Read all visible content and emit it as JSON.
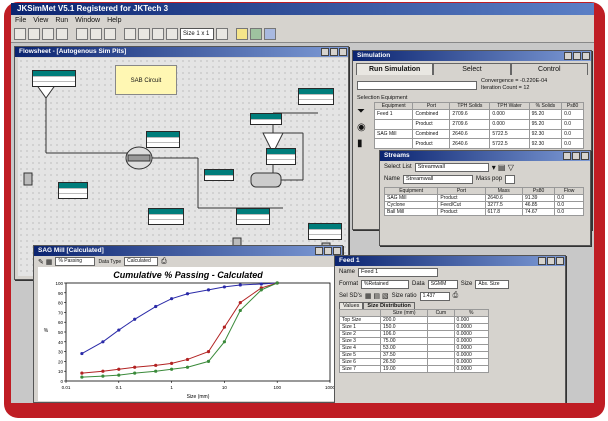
{
  "app": {
    "title": "JKSimMet V5.1 Registered for JKTech 3"
  },
  "menu": [
    "File",
    "View",
    "Run",
    "Window",
    "Help"
  ],
  "toolbar": {
    "zoom": "Size 1 x 1"
  },
  "flowsheet": {
    "title": "Flowsheet - [Autogenous Sim Pits]",
    "note": "SAB Circuit"
  },
  "simulation": {
    "title": "Simulation",
    "tabs": [
      "Run Simulation",
      "Select",
      "Control"
    ],
    "converge_label": "Convergence = -0.220E-04",
    "iter_label": "Iteration Count = 12",
    "section": "Selection Equipment",
    "headers": [
      "Equipment",
      "Port",
      "TPH Solids",
      "TPH Water",
      "% Solids",
      "Ps80"
    ],
    "rows": [
      [
        "Feed 1",
        "Combined",
        "2709.6",
        "0.000",
        "95.20",
        "0.0"
      ],
      [
        "",
        "Product",
        "2709.6",
        "0.000",
        "95.20",
        "0.0"
      ],
      [
        "SAG Mill",
        "Combined",
        "2640.6",
        "5722.5",
        "92.30",
        "0.0"
      ],
      [
        "",
        "Product",
        "2640.6",
        "5722.5",
        "92.30",
        "0.0"
      ]
    ]
  },
  "streams": {
    "title": "Streams",
    "select_label": "Select List",
    "select_value": "Streamwall",
    "name_label": "Name",
    "name_value": "Streamwall",
    "mass_label": "Mass pop",
    "headers": [
      "Equipment",
      "Port",
      "Mass",
      "Ps80",
      "Flow"
    ],
    "rows": [
      [
        "SAG Mill",
        "Product",
        "2640.6",
        "91.39",
        "0.0"
      ],
      [
        "Cyclone",
        "Feed/Cut",
        "3277.5",
        "46.85",
        "0.0"
      ],
      [
        "Ball Mill",
        "Product",
        "617.8",
        "74.67",
        "0.0"
      ]
    ]
  },
  "chartwin": {
    "title": "SAG Mill [Calculated]",
    "toolbar_label": "% Passing",
    "toolbar_label2": "Data Type",
    "toolbar_value2": "Calculated"
  },
  "chart_data": {
    "type": "line",
    "title": "Cumulative % Passing - Calculated",
    "xlabel": "Size (mm)",
    "ylabel": "%",
    "x_scale": "log",
    "xlim": [
      0.01,
      1000
    ],
    "ylim": [
      0,
      100
    ],
    "x_ticks": [
      "0.01",
      "0.1",
      "1",
      "10",
      "100",
      "1000"
    ],
    "y_ticks": [
      "0",
      "10",
      "20",
      "30",
      "40",
      "50",
      "60",
      "70",
      "80",
      "90",
      "100"
    ],
    "series": [
      {
        "color": "#2a2aa8",
        "x": [
          0.02,
          0.05,
          0.1,
          0.2,
          0.5,
          1,
          2,
          5,
          10,
          20,
          50,
          100
        ],
        "y": [
          28,
          40,
          52,
          63,
          76,
          84,
          89,
          93,
          96,
          98,
          99,
          100
        ]
      },
      {
        "color": "#b22222",
        "x": [
          0.02,
          0.05,
          0.1,
          0.2,
          0.5,
          1,
          2,
          5,
          10,
          20,
          50,
          100
        ],
        "y": [
          8,
          10,
          12,
          14,
          16,
          18,
          22,
          30,
          55,
          80,
          95,
          100
        ]
      },
      {
        "color": "#3a8a3a",
        "x": [
          0.02,
          0.05,
          0.1,
          0.2,
          0.5,
          1,
          2,
          5,
          10,
          20,
          50,
          100
        ],
        "y": [
          4,
          5,
          6,
          8,
          10,
          12,
          14,
          20,
          40,
          72,
          93,
          100
        ]
      }
    ]
  },
  "feedwin": {
    "title": "Feed 1",
    "name_label": "Name",
    "name_value": "Feed 1",
    "format_label": "Format",
    "format_value": "%Retained",
    "data_label": "Data",
    "data_value": "SGMM",
    "size_label": "Size",
    "size_value": "Abs. Size",
    "sel_label": "Sel SD's",
    "size_ratio_label": "Size ratio",
    "size_ratio_value": "1.437",
    "tabs": [
      "Values",
      "Size Distribution"
    ],
    "headers": [
      "Size (mm)",
      "Cum",
      "%"
    ],
    "rows": [
      [
        "Top Size",
        "200.0",
        "0.000"
      ],
      [
        "Size 1",
        "150.0",
        "0.0000"
      ],
      [
        "Size 2",
        "106.0",
        "0.0000"
      ],
      [
        "Size 3",
        "75.00",
        "0.0000"
      ],
      [
        "Size 4",
        "53.00",
        "0.0000"
      ],
      [
        "Size 5",
        "37.50",
        "0.0000"
      ],
      [
        "Size 6",
        "26.50",
        "0.0000"
      ],
      [
        "Size 7",
        "19.00",
        "0.0000"
      ]
    ]
  }
}
